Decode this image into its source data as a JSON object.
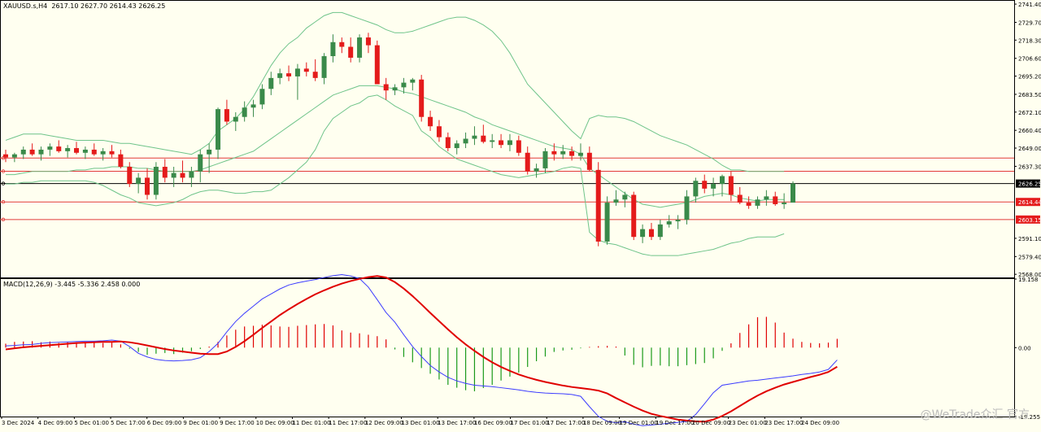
{
  "header": {
    "symbol": "XAUUSD.s,H4",
    "open": "2617.10",
    "high": "2627.70",
    "low": "2614.43",
    "close": "2626.25"
  },
  "macd_header": "MACD(12,26,9) -3.445 -5.336 2.458 0.000",
  "watermark": "@WeTrade众汇 官方",
  "colors": {
    "background": "#fffff0",
    "bull": "#3a8a4a",
    "bear": "#e41b1b",
    "bands": "#6fc48a",
    "hline": "#e23b3b",
    "macd_line": "#3c3cff",
    "signal_line": "#e00000"
  },
  "chart_data": [
    {
      "type": "candlestick",
      "title": "XAUUSD.s,H4",
      "price_axis_ticks": [
        "2741.40",
        "2729.70",
        "2718.30",
        "2706.60",
        "2695.20",
        "2683.50",
        "2672.10",
        "2660.40",
        "2649.00",
        "2637.30",
        "2626.25",
        "2614.44",
        "2603.15",
        "2591.10",
        "2579.40",
        "2568.00"
      ],
      "ylim": [
        2566,
        2743
      ],
      "time_labels": [
        "3 Dec 2024",
        "4 Dec 09:00",
        "5 Dec 01:00",
        "5 Dec 17:00",
        "6 Dec 09:00",
        "9 Dec 01:00",
        "9 Dec 17:00",
        "10 Dec 09:00",
        "11 Dec 01:00",
        "11 Dec 17:00",
        "12 Dec 09:00",
        "13 Dec 01:00",
        "13 Dec 17:00",
        "16 Dec 09:00",
        "17 Dec 01:00",
        "17 Dec 17:00",
        "18 Dec 09:00",
        "19 Dec 01:00",
        "19 Dec 17:00",
        "20 Dec 09:00",
        "23 Dec 01:00",
        "23 Dec 17:00",
        "24 Dec 09:00"
      ],
      "horizontal_lines": [
        {
          "price": 2642.62,
          "label": "2642.62",
          "color": "#e23b3b"
        },
        {
          "price": 2634.14,
          "label": "2634.14",
          "color": "#e23b3b"
        },
        {
          "price": 2626.25,
          "label": "2626.25",
          "color": "#000000"
        },
        {
          "price": 2614.44,
          "label": "2614.44",
          "color": "#e23b3b"
        },
        {
          "price": 2603.15,
          "label": "2603.15",
          "color": "#e23b3b"
        }
      ],
      "ohlc": [
        [
          2645,
          2648,
          2640,
          2643
        ],
        [
          2643,
          2646,
          2640,
          2645
        ],
        [
          2645,
          2650,
          2642,
          2648
        ],
        [
          2648,
          2652,
          2644,
          2645
        ],
        [
          2645,
          2650,
          2641,
          2648
        ],
        [
          2648,
          2652,
          2644,
          2650
        ],
        [
          2650,
          2654,
          2646,
          2647
        ],
        [
          2647,
          2651,
          2643,
          2649
        ],
        [
          2649,
          2653,
          2645,
          2646
        ],
        [
          2646,
          2650,
          2642,
          2648
        ],
        [
          2648,
          2652,
          2644,
          2645
        ],
        [
          2645,
          2649,
          2641,
          2647
        ],
        [
          2647,
          2651,
          2643,
          2645
        ],
        [
          2645,
          2648,
          2636,
          2637
        ],
        [
          2637,
          2640,
          2624,
          2626
        ],
        [
          2626,
          2633,
          2620,
          2630
        ],
        [
          2630,
          2636,
          2616,
          2619
        ],
        [
          2619,
          2640,
          2616,
          2637
        ],
        [
          2637,
          2642,
          2627,
          2630
        ],
        [
          2630,
          2637,
          2624,
          2633
        ],
        [
          2633,
          2641,
          2627,
          2630
        ],
        [
          2630,
          2637,
          2624,
          2634
        ],
        [
          2634,
          2648,
          2627,
          2645
        ],
        [
          2645,
          2652,
          2633,
          2648
        ],
        [
          2648,
          2675,
          2642,
          2674
        ],
        [
          2674,
          2680,
          2664,
          2666
        ],
        [
          2666,
          2672,
          2660,
          2669
        ],
        [
          2669,
          2679,
          2666,
          2675
        ],
        [
          2675,
          2680,
          2669,
          2677
        ],
        [
          2677,
          2690,
          2674,
          2687
        ],
        [
          2687,
          2698,
          2683,
          2694
        ],
        [
          2694,
          2700,
          2690,
          2697
        ],
        [
          2697,
          2702,
          2692,
          2695
        ],
        [
          2695,
          2703,
          2680,
          2700
        ],
        [
          2700,
          2704,
          2695,
          2698
        ],
        [
          2698,
          2706,
          2692,
          2694
        ],
        [
          2694,
          2710,
          2690,
          2708
        ],
        [
          2708,
          2722,
          2704,
          2717
        ],
        [
          2717,
          2720,
          2710,
          2714
        ],
        [
          2714,
          2720,
          2704,
          2707
        ],
        [
          2707,
          2722,
          2704,
          2720
        ],
        [
          2720,
          2723,
          2710,
          2715
        ],
        [
          2715,
          2718,
          2692,
          2690
        ],
        [
          2690,
          2694,
          2680,
          2686
        ],
        [
          2686,
          2690,
          2683,
          2688
        ],
        [
          2688,
          2694,
          2684,
          2691
        ],
        [
          2691,
          2694,
          2686,
          2693
        ],
        [
          2693,
          2696,
          2666,
          2669
        ],
        [
          2669,
          2673,
          2660,
          2663
        ],
        [
          2663,
          2667,
          2653,
          2656
        ],
        [
          2656,
          2659,
          2647,
          2649
        ],
        [
          2649,
          2654,
          2645,
          2652
        ],
        [
          2652,
          2659,
          2649,
          2655
        ],
        [
          2655,
          2663,
          2651,
          2657
        ],
        [
          2657,
          2664,
          2652,
          2653
        ],
        [
          2653,
          2658,
          2649,
          2654
        ],
        [
          2654,
          2658,
          2649,
          2651
        ],
        [
          2651,
          2658,
          2647,
          2654
        ],
        [
          2654,
          2657,
          2644,
          2646
        ],
        [
          2646,
          2650,
          2632,
          2634
        ],
        [
          2634,
          2639,
          2630,
          2636
        ],
        [
          2636,
          2649,
          2633,
          2647
        ],
        [
          2647,
          2652,
          2641,
          2645
        ],
        [
          2645,
          2651,
          2642,
          2647
        ],
        [
          2647,
          2650,
          2641,
          2644
        ],
        [
          2644,
          2652,
          2641,
          2646
        ],
        [
          2646,
          2650,
          2634,
          2635
        ],
        [
          2635,
          2640,
          2586,
          2589
        ],
        [
          2589,
          2618,
          2587,
          2614
        ],
        [
          2614,
          2622,
          2612,
          2616
        ],
        [
          2616,
          2621,
          2611,
          2619
        ],
        [
          2619,
          2621,
          2590,
          2592
        ],
        [
          2592,
          2600,
          2588,
          2597
        ],
        [
          2597,
          2601,
          2590,
          2592
        ],
        [
          2592,
          2603,
          2590,
          2600
        ],
        [
          2600,
          2606,
          2598,
          2602
        ],
        [
          2602,
          2606,
          2597,
          2603
        ],
        [
          2603,
          2622,
          2600,
          2618
        ],
        [
          2618,
          2630,
          2614,
          2628
        ],
        [
          2628,
          2632,
          2620,
          2623
        ],
        [
          2623,
          2630,
          2618,
          2626
        ],
        [
          2626,
          2632,
          2618,
          2631
        ],
        [
          2631,
          2634,
          2615,
          2619
        ],
        [
          2619,
          2624,
          2613,
          2614
        ],
        [
          2614,
          2618,
          2610,
          2612
        ],
        [
          2612,
          2618,
          2610,
          2616
        ],
        [
          2616,
          2622,
          2612,
          2618
        ],
        [
          2618,
          2621,
          2612,
          2613
        ],
        [
          2613,
          2620,
          2610,
          2614
        ],
        [
          2614,
          2627.7,
          2614.43,
          2626.25
        ]
      ],
      "bollinger": {
        "upper": [
          2654,
          2656,
          2658,
          2658,
          2658,
          2657,
          2656,
          2655,
          2654,
          2654,
          2654,
          2654,
          2653,
          2652,
          2652,
          2651,
          2650,
          2649,
          2648,
          2647,
          2646,
          2645,
          2648,
          2652,
          2660,
          2664,
          2668,
          2674,
          2682,
          2692,
          2702,
          2710,
          2716,
          2720,
          2726,
          2730,
          2734,
          2736,
          2736,
          2734,
          2732,
          2730,
          2728,
          2725,
          2723,
          2723,
          2724,
          2726,
          2728,
          2730,
          2732,
          2733,
          2733,
          2731,
          2728,
          2724,
          2718,
          2710,
          2700,
          2690,
          2684,
          2678,
          2672,
          2666,
          2660,
          2655,
          2668,
          2670,
          2669,
          2669,
          2668,
          2666,
          2663,
          2660,
          2657,
          2655,
          2653,
          2651,
          2648,
          2645,
          2642,
          2638,
          2635,
          2635,
          2634,
          2634,
          2634,
          2634,
          2634
        ],
        "middle": [
          2632,
          2632,
          2633,
          2634,
          2634,
          2634,
          2634,
          2634,
          2635,
          2635,
          2636,
          2636,
          2637,
          2637,
          2637,
          2636,
          2636,
          2635,
          2634,
          2634,
          2634,
          2634,
          2635,
          2637,
          2639,
          2641,
          2643,
          2645,
          2647,
          2651,
          2655,
          2659,
          2663,
          2667,
          2671,
          2675,
          2679,
          2683,
          2685,
          2687,
          2689,
          2689,
          2689,
          2688,
          2687,
          2685,
          2684,
          2682,
          2680,
          2678,
          2676,
          2674,
          2672,
          2669,
          2667,
          2664,
          2662,
          2660,
          2658,
          2656,
          2654,
          2652,
          2650,
          2649,
          2648,
          2645,
          2636,
          2632,
          2628,
          2624,
          2620,
          2616,
          2613,
          2612,
          2611,
          2612,
          2613,
          2614,
          2616,
          2618,
          2619,
          2620,
          2619,
          2617,
          2616,
          2615,
          2616,
          2616,
          2616
        ],
        "lower": [
          2626,
          2626,
          2627,
          2627,
          2628,
          2628,
          2628,
          2628,
          2628,
          2628,
          2627,
          2625,
          2622,
          2619,
          2617,
          2614,
          2613,
          2612,
          2613,
          2614,
          2616,
          2619,
          2621,
          2622,
          2622,
          2621,
          2620,
          2620,
          2621,
          2621,
          2622,
          2626,
          2630,
          2635,
          2640,
          2648,
          2660,
          2668,
          2672,
          2676,
          2678,
          2682,
          2683,
          2680,
          2676,
          2673,
          2670,
          2660,
          2656,
          2650,
          2646,
          2642,
          2640,
          2638,
          2636,
          2634,
          2632,
          2631,
          2630,
          2631,
          2632,
          2633,
          2634,
          2636,
          2637,
          2636,
          2595,
          2590,
          2588,
          2587,
          2585,
          2583,
          2581,
          2580,
          2580,
          2580,
          2580,
          2581,
          2582,
          2583,
          2584,
          2586,
          2588,
          2589,
          2591,
          2592,
          2592,
          2592,
          2594
        ]
      }
    },
    {
      "type": "macd",
      "title": "MACD(12,26,9)",
      "values": {
        "macd": "-3.445",
        "signal": "-5.336",
        "histogram": "2.458",
        "zero": "0.000"
      },
      "axis_ticks": [
        "19.158",
        "0.00",
        "-19.255"
      ],
      "ylim": [
        -19.255,
        19.158
      ],
      "histogram": [
        1.1,
        1.6,
        1.7,
        1.8,
        1.5,
        1.7,
        1.3,
        1.5,
        1.5,
        1.5,
        1.5,
        1.3,
        1.4,
        0.9,
        -0.3,
        -1.2,
        -2.0,
        -1.7,
        -1.5,
        -1.8,
        -1.4,
        -1.0,
        -0.4,
        0.3,
        1.6,
        3.4,
        5.0,
        5.9,
        6.1,
        6.4,
        6.2,
        5.9,
        5.8,
        6.1,
        6.3,
        6.5,
        6.6,
        6.2,
        4.8,
        4.2,
        4.0,
        3.6,
        3.2,
        2.3,
        -0.5,
        -2.6,
        -4.1,
        -5.7,
        -7.3,
        -8.9,
        -10.4,
        -11.2,
        -11.9,
        -12.2,
        -11.3,
        -10.4,
        -9.2,
        -8.1,
        -7.0,
        -5.4,
        -3.8,
        -2.5,
        -1.2,
        -0.8,
        -0.6,
        -0.2,
        0.2,
        0.4,
        0.5,
        0.3,
        -2.2,
        -4.8,
        -5.5,
        -5.1,
        -5.0,
        -5.2,
        -5.2,
        -4.9,
        -4.6,
        -4.3,
        -3.0,
        -0.9,
        1.2,
        4.1,
        6.5,
        8.5,
        8.6,
        7.0,
        4.2,
        2.5,
        1.6,
        1.3,
        1.2,
        1.4,
        2.458
      ],
      "macd": [
        0.5,
        0.6,
        0.8,
        0.9,
        1.2,
        1.4,
        1.5,
        1.6,
        1.7,
        1.8,
        1.8,
        1.9,
        2.1,
        1.8,
        0.3,
        -1.6,
        -2.6,
        -3.3,
        -3.6,
        -3.7,
        -3.6,
        -3.4,
        -2.8,
        -1.1,
        1.2,
        4.4,
        7.3,
        9.6,
        11.6,
        13.6,
        15.0,
        16.4,
        17.5,
        18.1,
        18.6,
        19.0,
        19.6,
        20.1,
        20.4,
        20.0,
        19.3,
        16.9,
        13.4,
        9.8,
        7.1,
        3.6,
        0.3,
        -2.5,
        -5.0,
        -6.8,
        -8.3,
        -9.3,
        -10.0,
        -10.5,
        -10.7,
        -10.9,
        -11.2,
        -11.5,
        -11.8,
        -12.2,
        -12.5,
        -12.7,
        -12.8,
        -12.9,
        -13.1,
        -13.6,
        -16.5,
        -19.2,
        -20.6,
        -21.0,
        -20.7,
        -21.4,
        -21.8,
        -21.6,
        -21.4,
        -21.1,
        -20.9,
        -20.6,
        -18.7,
        -15.7,
        -12.6,
        -10.5,
        -10.1,
        -9.7,
        -9.3,
        -9.1,
        -8.8,
        -8.5,
        -8.2,
        -7.9,
        -7.5,
        -7.2,
        -6.8,
        -6.1,
        -3.445
      ],
      "signal": [
        -0.5,
        -0.2,
        0.1,
        0.3,
        0.5,
        0.7,
        0.9,
        1.1,
        1.3,
        1.4,
        1.5,
        1.6,
        1.6,
        1.7,
        1.5,
        1.1,
        0.6,
        0.1,
        -0.4,
        -0.8,
        -1.1,
        -1.4,
        -1.7,
        -1.8,
        -1.8,
        -1.1,
        0.2,
        1.8,
        3.6,
        5.5,
        7.3,
        9.1,
        10.7,
        12.2,
        13.6,
        14.9,
        16.0,
        17.0,
        17.9,
        18.6,
        19.2,
        19.7,
        20.0,
        19.6,
        18.3,
        16.5,
        14.4,
        12.1,
        9.7,
        7.4,
        5.1,
        2.9,
        0.9,
        -0.9,
        -2.6,
        -4.1,
        -5.4,
        -6.5,
        -7.5,
        -8.3,
        -9.0,
        -9.6,
        -10.1,
        -10.6,
        -11.0,
        -11.3,
        -11.6,
        -12.0,
        -12.8,
        -14.1,
        -15.3,
        -16.5,
        -17.6,
        -18.5,
        -19.1,
        -19.6,
        -20.1,
        -20.4,
        -20.6,
        -20.7,
        -20.1,
        -19.1,
        -17.8,
        -16.3,
        -14.8,
        -13.4,
        -12.2,
        -11.2,
        -10.3,
        -9.6,
        -8.9,
        -8.2,
        -7.6,
        -6.8,
        -5.336
      ]
    }
  ]
}
